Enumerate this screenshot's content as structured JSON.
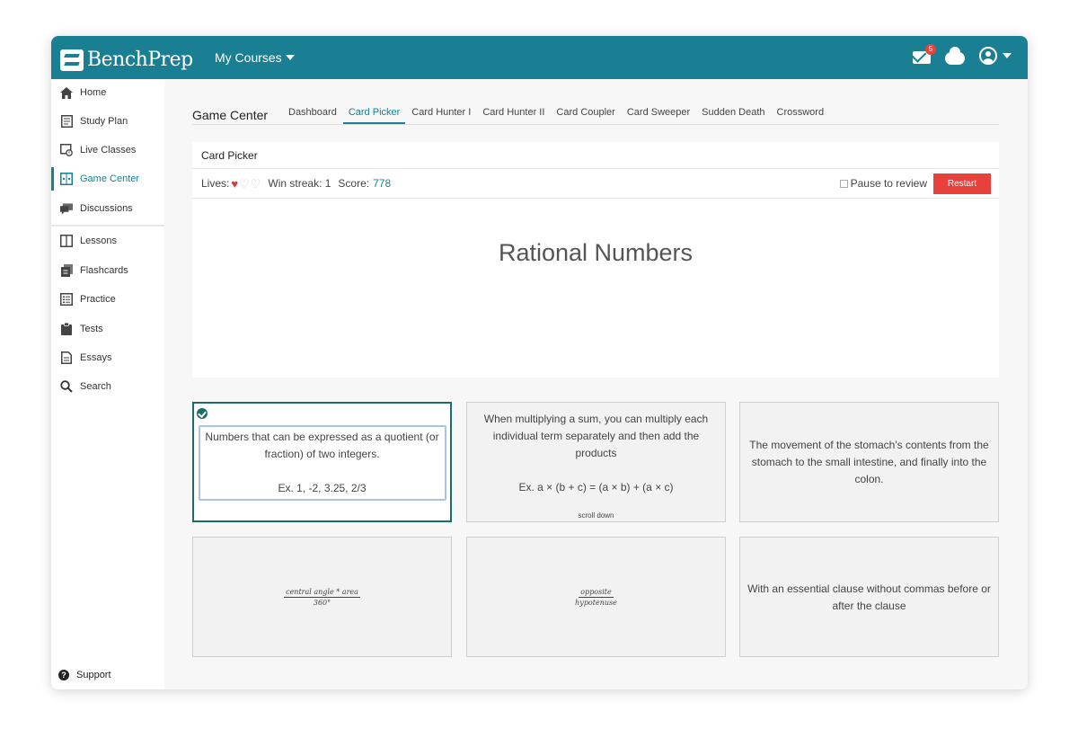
{
  "header": {
    "logo_text": "BenchPrep",
    "courses_label": "My Courses",
    "mail_badge": "5"
  },
  "sidebar": {
    "items": [
      {
        "label": "Home"
      },
      {
        "label": "Study Plan"
      },
      {
        "label": "Live Classes"
      },
      {
        "label": "Game Center"
      },
      {
        "label": "Discussions"
      },
      {
        "label": "Lessons"
      },
      {
        "label": "Flashcards"
      },
      {
        "label": "Practice"
      },
      {
        "label": "Tests"
      },
      {
        "label": "Essays"
      },
      {
        "label": "Search"
      }
    ],
    "active_index": 3,
    "support_label": "Support"
  },
  "main": {
    "title": "Game Center",
    "tabs": [
      {
        "label": "Dashboard"
      },
      {
        "label": "Card Picker"
      },
      {
        "label": "Card Hunter I"
      },
      {
        "label": "Card Hunter II"
      },
      {
        "label": "Card Coupler"
      },
      {
        "label": "Card Sweeper"
      },
      {
        "label": "Sudden Death"
      },
      {
        "label": "Crossword"
      }
    ],
    "active_tab": 1
  },
  "game": {
    "panel_title": "Card Picker",
    "lives_label": "Lives:",
    "lives_total": 3,
    "lives_remaining": 1,
    "win_streak_label": "Win streak: 1",
    "score_label": "Score:",
    "score_value": "778",
    "pause_label": "Pause to review",
    "restart_label": "Restart",
    "prompt": "Rational Numbers"
  },
  "cards": [
    {
      "line1": "Numbers that can be expressed as a quotient (or fraction) of two integers.",
      "line2": "Ex. 1, -2, 3.25, 2/3",
      "selected": true
    },
    {
      "line1": "When multiplying a sum, you can multiply each individual term separately and then add the products",
      "line2": "Ex. a × (b + c) = (a × b) + (a × c)",
      "hint": "scroll down"
    },
    {
      "line1": "The movement of the stomach's contents from the stomach to the small intestine, and finally into the colon."
    },
    {
      "numerator": "central angle * area",
      "denominator": "360°"
    },
    {
      "numerator": "opposite",
      "denominator": "hypotenuse"
    },
    {
      "line1": "With an essential clause without commas before or after the clause"
    }
  ],
  "colors": {
    "brand": "#1a7f92",
    "restart": "#e8403a",
    "selected_border": "#1a6e66",
    "heart": "#d13b3b"
  }
}
